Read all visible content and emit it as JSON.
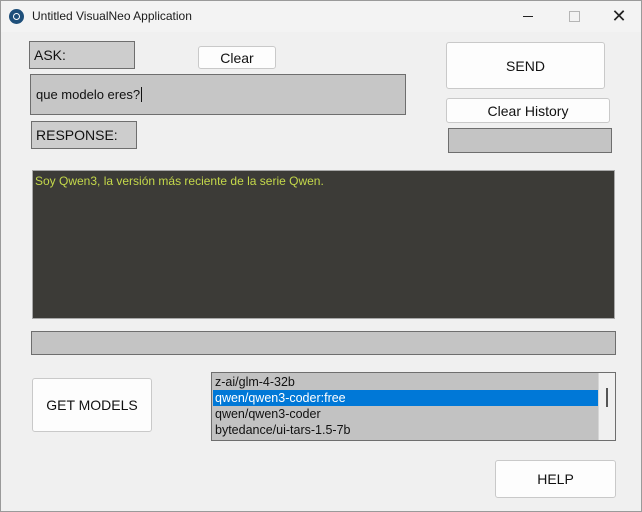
{
  "window": {
    "title": "Untitled VisualNeo Application",
    "close_glyph": "✕"
  },
  "ask": {
    "label": "ASK:",
    "clear_label": "Clear",
    "input_value": "que modelo eres?"
  },
  "send": {
    "label": "SEND"
  },
  "clear_history": {
    "label": "Clear History"
  },
  "response": {
    "label": "RESPONSE:",
    "text": "Soy Qwen3, la versión más reciente de la serie Qwen."
  },
  "models": {
    "button_label": "GET MODELS",
    "items": [
      "z-ai/glm-4-32b",
      "qwen/qwen3-coder:free",
      "qwen/qwen3-coder",
      "bytedance/ui-tars-1.5-7b"
    ],
    "selected": "qwen/qwen3-coder:free"
  },
  "help": {
    "label": "HELP"
  },
  "colors": {
    "response_bg": "#3c3b37",
    "response_text": "#c4d84a",
    "selection": "#0078d7"
  },
  "icons": {
    "app": "app-logo-icon",
    "minimize": "minimize-icon",
    "maximize": "maximize-icon",
    "close": "close-icon"
  }
}
